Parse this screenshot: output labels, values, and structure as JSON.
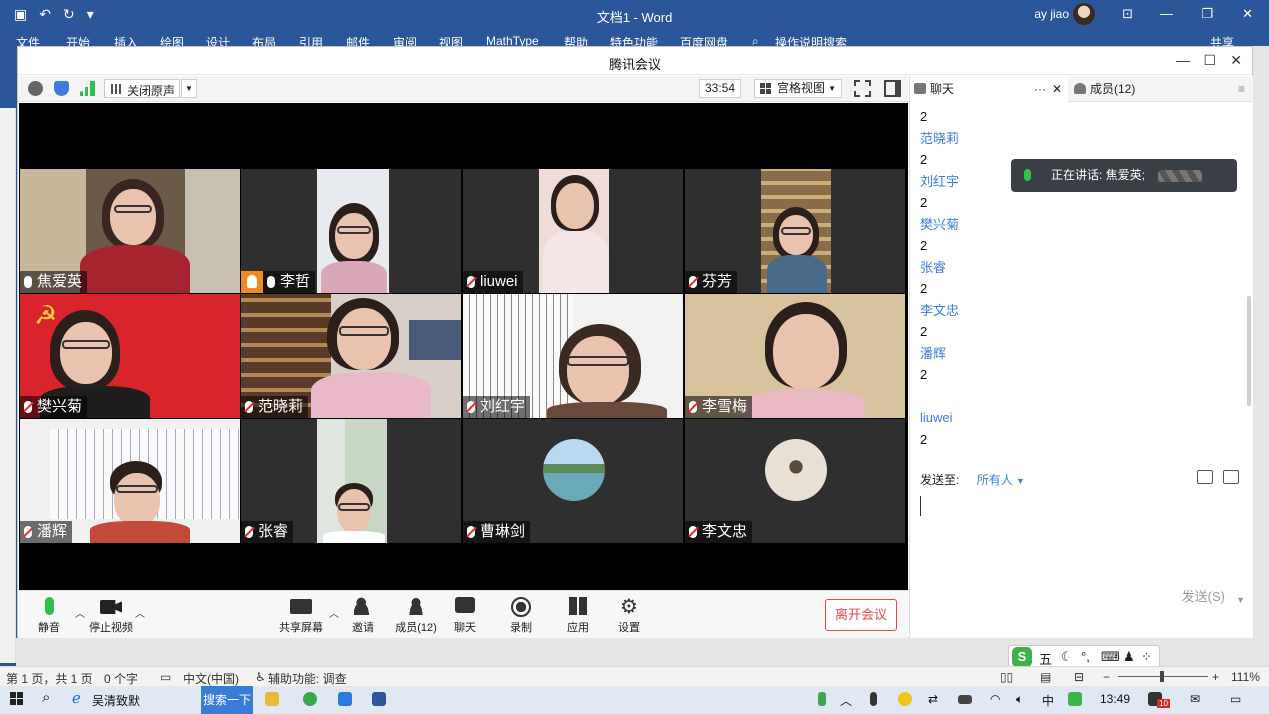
{
  "word": {
    "doc_title": "文档1 - Word",
    "user": "ay jiao",
    "ribbon_tabs": [
      "文件",
      "开始",
      "插入",
      "绘图",
      "设计",
      "布局",
      "引用",
      "邮件",
      "审阅",
      "视图",
      "MathType",
      "帮助",
      "特色功能",
      "百度网盘",
      "操作说明搜索",
      "共享"
    ]
  },
  "meeting": {
    "window_title": "腾讯会议",
    "toolbar": {
      "audio_label": "关闭原声",
      "timer": "33:54",
      "view_label": "宫格视图"
    },
    "participants": [
      {
        "name": "焦爱英",
        "muted": false,
        "active": true,
        "host": false,
        "bg": "#5a4b3c"
      },
      {
        "name": "李哲",
        "muted": false,
        "active": false,
        "host": true,
        "bg": "#2f2f2f"
      },
      {
        "name": "liuwei",
        "muted": true,
        "active": false,
        "host": false,
        "bg": "#2f2f2f"
      },
      {
        "name": "芬芳",
        "muted": true,
        "active": false,
        "host": false,
        "bg": "#2f2f2f"
      },
      {
        "name": "樊兴菊",
        "muted": true,
        "active": false,
        "host": false,
        "bg": "#d8242a"
      },
      {
        "name": "范晓莉",
        "muted": true,
        "active": false,
        "host": false,
        "bg": "#6b4a35"
      },
      {
        "name": "刘红宇",
        "muted": true,
        "active": false,
        "host": false,
        "bg": "#e9e9e9"
      },
      {
        "name": "李雪梅",
        "muted": true,
        "active": false,
        "host": false,
        "bg": "#d9c29e"
      },
      {
        "name": "潘辉",
        "muted": true,
        "active": false,
        "host": false,
        "bg": "#ededed"
      },
      {
        "name": "张睿",
        "muted": true,
        "active": false,
        "host": false,
        "bg": "#2f2f2f"
      },
      {
        "name": "曹琳剑",
        "muted": true,
        "active": false,
        "host": false,
        "bg": "#2f2f2f"
      },
      {
        "name": "李文忠",
        "muted": true,
        "active": false,
        "host": false,
        "bg": "#2f2f2f"
      }
    ],
    "controls": {
      "mute": "静音",
      "stop_video": "停止视频",
      "share_screen": "共享屏幕",
      "invite": "邀请",
      "members": "成员(12)",
      "chat": "聊天",
      "record": "录制",
      "apps": "应用",
      "settings": "设置",
      "leave": "离开会议"
    },
    "chat": {
      "tab_chat": "聊天",
      "tab_members": "成员(12)",
      "messages": [
        {
          "sender": "",
          "text": "2"
        },
        {
          "sender": "范晓莉",
          "text": "2"
        },
        {
          "sender": "刘红宇",
          "text": "2"
        },
        {
          "sender": "樊兴菊",
          "text": "2"
        },
        {
          "sender": "张睿",
          "text": "2"
        },
        {
          "sender": "李文忠",
          "text": "2"
        },
        {
          "sender": "潘辉",
          "text": "2"
        },
        {
          "sender": "",
          "text": ""
        },
        {
          "sender": "liuwei",
          "text": "2"
        }
      ],
      "speaking_label": "正在讲话: 焦爱英;",
      "send_to_label": "发送至:",
      "send_to_value": "所有人",
      "send_button": "发送(S)"
    }
  },
  "statusbar": {
    "page": "第 1 页，共 1 页",
    "words": "0 个字",
    "lang": "中文(中国)",
    "accessibility": "辅助功能: 调查",
    "zoom": "111%"
  },
  "ime": {
    "mode": "五"
  },
  "taskbar": {
    "browser_tab": "吴清致默",
    "search_btn": "搜索一下",
    "time": "13:49",
    "badge": "10"
  },
  "colors": {
    "accent_blue": "#2b579a",
    "chat_sender": "#3b7ddd",
    "leave_red": "#e04a4a",
    "active_green": "#2fbf4a"
  }
}
